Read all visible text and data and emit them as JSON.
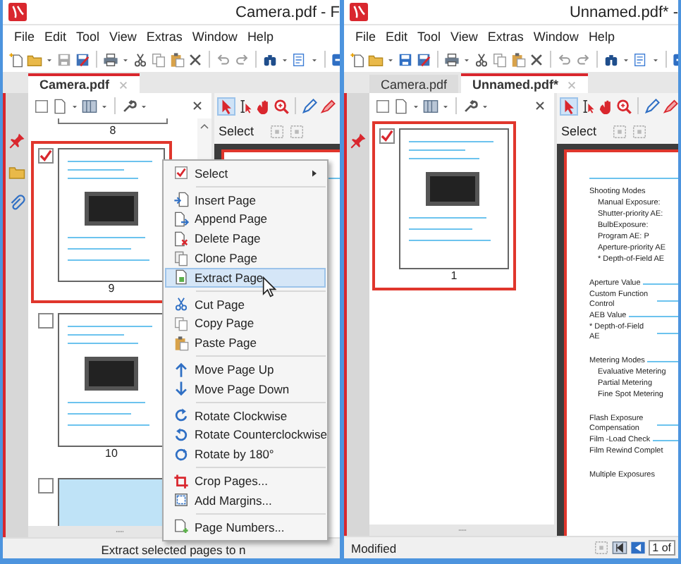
{
  "windows": [
    {
      "title": "Camera.pdf - F",
      "save_enabled": false,
      "menu": [
        "File",
        "Edit",
        "Tool",
        "View",
        "Extras",
        "Window",
        "Help"
      ],
      "tabs": [
        {
          "label": "Camera.pdf",
          "selected": true
        }
      ],
      "thumbnails": [
        {
          "kind": "tail",
          "label": "8"
        },
        {
          "kind": "full",
          "label": "9",
          "checked": true,
          "selected": true
        },
        {
          "kind": "full",
          "label": "10",
          "checked": false,
          "selected": false
        },
        {
          "kind": "head",
          "checked": false,
          "selected": false
        }
      ],
      "tool_label": "Select",
      "status": "Extract selected pages to n"
    },
    {
      "title": "Unnamed.pdf* -",
      "save_enabled": true,
      "menu": [
        "File",
        "Edit",
        "Tool",
        "View",
        "Extras",
        "Window",
        "Help"
      ],
      "tabs": [
        {
          "label": "Camera.pdf",
          "selected": false
        },
        {
          "label": "Unnamed.pdf*",
          "selected": true
        }
      ],
      "thumbnails": [
        {
          "kind": "full",
          "label": "1",
          "checked": true,
          "selected": true
        }
      ],
      "tool_label": "Select",
      "status": "Modified",
      "page_indicator": "1 of",
      "document_groups": [
        [
          {
            "kind": "heading",
            "text": "Shooting Modes"
          },
          {
            "kind": "sub",
            "text": "Manual Exposure:"
          },
          {
            "kind": "sub",
            "text": "Shutter-priority AE:"
          },
          {
            "kind": "sub",
            "text": "BulbExposure:"
          },
          {
            "kind": "sub",
            "text": "Program AE: P"
          },
          {
            "kind": "sub",
            "text": "Aperture-priority AE"
          },
          {
            "kind": "sub",
            "text": "* Depth-of-Field AE"
          }
        ],
        [
          {
            "kind": "leader",
            "text": "Aperture Value"
          },
          {
            "kind": "leader",
            "text": "Custom Function Control"
          },
          {
            "kind": "leader",
            "text": "AEB Value"
          },
          {
            "kind": "leader",
            "text": "* Depth-of-Field AE"
          }
        ],
        [
          {
            "kind": "leader",
            "text": "Metering Modes"
          },
          {
            "kind": "sub",
            "text": "Evaluative Metering"
          },
          {
            "kind": "sub",
            "text": "Partial Metering"
          },
          {
            "kind": "sub",
            "text": "Fine Spot Metering"
          }
        ],
        [
          {
            "kind": "leader",
            "text": "Flash Exposure Compensation"
          },
          {
            "kind": "leader",
            "text": "Film -Load Check"
          },
          {
            "kind": "heading",
            "text": "Film Rewind Complet"
          }
        ],
        [
          {
            "kind": "heading",
            "text": "Multiple Exposures"
          }
        ]
      ]
    }
  ],
  "context_menu": {
    "items": [
      {
        "kind": "item",
        "label": "Select",
        "submenu": true,
        "selected": false
      },
      {
        "kind": "separator"
      },
      {
        "kind": "item",
        "label": "Insert Page",
        "selected": false
      },
      {
        "kind": "item",
        "label": "Append Page",
        "selected": false
      },
      {
        "kind": "item",
        "label": "Delete Page",
        "selected": false
      },
      {
        "kind": "item",
        "label": "Clone Page",
        "selected": false
      },
      {
        "kind": "item",
        "label": "Extract Page",
        "selected": true
      },
      {
        "kind": "separator"
      },
      {
        "kind": "item",
        "label": "Cut Page",
        "selected": false
      },
      {
        "kind": "item",
        "label": "Copy Page",
        "selected": false
      },
      {
        "kind": "item",
        "label": "Paste Page",
        "selected": false
      },
      {
        "kind": "separator"
      },
      {
        "kind": "item",
        "label": "Move Page Up",
        "selected": false
      },
      {
        "kind": "item",
        "label": "Move Page Down",
        "selected": false
      },
      {
        "kind": "separator"
      },
      {
        "kind": "item",
        "label": "Rotate Clockwise",
        "selected": false
      },
      {
        "kind": "item",
        "label": "Rotate Counterclockwise",
        "selected": false
      },
      {
        "kind": "item",
        "label": "Rotate by 180°",
        "selected": false
      },
      {
        "kind": "separator"
      },
      {
        "kind": "item",
        "label": "Crop Pages...",
        "selected": false
      },
      {
        "kind": "item",
        "label": "Add Margins...",
        "selected": false
      },
      {
        "kind": "separator"
      },
      {
        "kind": "item",
        "label": "Page Numbers...",
        "selected": false
      }
    ]
  }
}
